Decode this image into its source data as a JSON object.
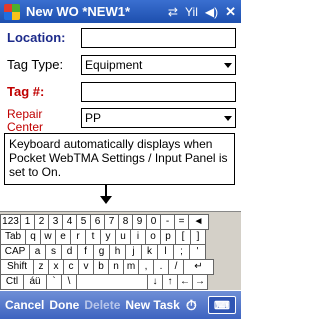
{
  "titlebar": {
    "title": "New WO *NEW1*",
    "icons": [
      "windows-logo",
      "connectivity-icon",
      "signal-icon",
      "volume-icon",
      "close-icon"
    ],
    "close_label": "✕",
    "volume_label": "◀)",
    "signal_label": "Yil",
    "conn_label": "⇄"
  },
  "form": {
    "location_label": "Location:",
    "location_value": "",
    "tag_type_label": "Tag Type:",
    "tag_type_value": "Equipment",
    "tag_label": "Tag #:",
    "tag_value": "",
    "repair_label": "Repair",
    "repair_label2": "Center",
    "repair_value": "PP"
  },
  "callout": {
    "text": "Keyboard automatically displays when Pocket WebTMA Settings / Input Panel is set to On."
  },
  "keyboard": {
    "row1": [
      "123",
      "1",
      "2",
      "3",
      "4",
      "5",
      "6",
      "7",
      "8",
      "9",
      "0",
      "-",
      "=",
      "◄"
    ],
    "row2": [
      "Tab",
      "q",
      "w",
      "e",
      "r",
      "t",
      "y",
      "u",
      "i",
      "o",
      "p",
      "[",
      "]"
    ],
    "row3": [
      "CAP",
      "a",
      "s",
      "d",
      "f",
      "g",
      "h",
      "j",
      "k",
      "l",
      ";",
      "'"
    ],
    "row4": [
      "Shift",
      "z",
      "x",
      "c",
      "v",
      "b",
      "n",
      "m",
      ",",
      ".",
      "/",
      "↵"
    ],
    "row5": [
      "Ctl",
      "áü",
      "`",
      "\\",
      "",
      "↓",
      "↑",
      "←",
      "→"
    ]
  },
  "menubar": {
    "cancel": "Cancel",
    "done": "Done",
    "delete": "Delete",
    "new_task": "New Task",
    "clock_icon": "⏱",
    "kbd_icon": "⌨"
  },
  "colors": {
    "titlebar": "#1d4fae",
    "label_blue": "#1c2a8a",
    "label_red": "#c00000",
    "menubar": "#3d63c0"
  }
}
